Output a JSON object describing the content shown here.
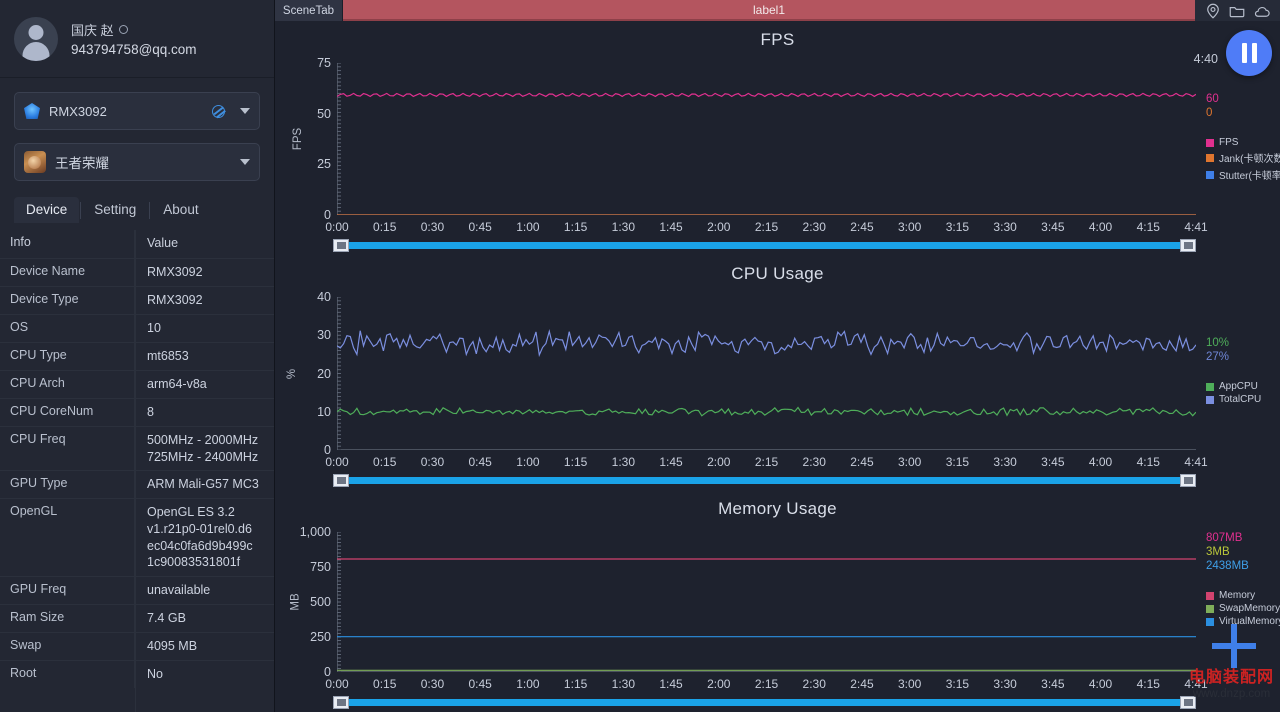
{
  "sidebar": {
    "profile": {
      "name": "国庆 赵",
      "email": "943794758@qq.com",
      "status_icon": "circle-icon",
      "avatar_icon": "avatar-icon"
    },
    "device_select": {
      "value": "RMX3092",
      "edit_icon": "pencil-icon",
      "caret_icon": "chevron-down-icon"
    },
    "game_select": {
      "value": "王者荣耀",
      "caret_icon": "chevron-down-icon"
    },
    "tabs": [
      {
        "label": "Device",
        "active": true
      },
      {
        "label": "Setting",
        "active": false
      },
      {
        "label": "About",
        "active": false
      }
    ],
    "table": {
      "headers": [
        "Info",
        "Value"
      ],
      "rows": [
        {
          "key": "Device Name",
          "value": "RMX3092"
        },
        {
          "key": "Device Type",
          "value": "RMX3092"
        },
        {
          "key": "OS",
          "value": "10"
        },
        {
          "key": "CPU Type",
          "value": "mt6853"
        },
        {
          "key": "CPU Arch",
          "value": "arm64-v8a"
        },
        {
          "key": "CPU CoreNum",
          "value": "8"
        },
        {
          "key": "CPU Freq",
          "value": "500MHz - 2000MHz\n725MHz - 2400MHz"
        },
        {
          "key": "GPU Type",
          "value": "ARM Mali-G57 MC3"
        },
        {
          "key": "OpenGL",
          "value": "OpenGL ES 3.2\nv1.r21p0-01rel0.d6\nec04c0fa6d9b499c\n1c90083531801f"
        },
        {
          "key": "GPU Freq",
          "value": "unavailable"
        },
        {
          "key": "Ram Size",
          "value": "7.4 GB"
        },
        {
          "key": "Swap",
          "value": "4095 MB"
        },
        {
          "key": "Root",
          "value": "No"
        }
      ]
    }
  },
  "topbar": {
    "scene_tab": "SceneTab",
    "label": "label1",
    "icons": [
      "location-pin-icon",
      "folder-icon",
      "cloud-icon"
    ],
    "accent_red": "#b4555f"
  },
  "controls": {
    "pause_button": "pause-icon",
    "elapsed": "4:40"
  },
  "watermark": {
    "cn": "电脑装配",
    "cn_accent": "网",
    "url": "www.dnzp.com"
  },
  "chart_data": [
    {
      "type": "line",
      "title": "FPS",
      "ylabel": "FPS",
      "xlabel": "",
      "ylim": [
        0,
        75
      ],
      "yticks": [
        0,
        25,
        50,
        75
      ],
      "ytick_labels": [
        "0",
        "25",
        "50",
        "75"
      ],
      "xticks": [
        "0:00",
        "0:15",
        "0:30",
        "0:45",
        "1:00",
        "1:15",
        "1:30",
        "1:45",
        "2:00",
        "2:15",
        "2:30",
        "2:45",
        "3:00",
        "3:15",
        "3:30",
        "3:45",
        "4:00",
        "4:15",
        "4:41"
      ],
      "grid": false,
      "legend_position": "right",
      "current_values": [
        {
          "label": "60",
          "color": "#e0308f"
        },
        {
          "label": "0",
          "color": "#e0762f"
        }
      ],
      "series": [
        {
          "name": "FPS",
          "color": "#e0308f",
          "mean": 60,
          "amplitude": 1.5,
          "note": "oscillating near 60"
        },
        {
          "name": "Jank(卡顿次数)",
          "color": "#e0762f",
          "mean": 0,
          "amplitude": 0
        },
        {
          "name": "Stutter(卡顿率)",
          "color": "#3f7fe8",
          "mean": 0,
          "amplitude": 0
        }
      ]
    },
    {
      "type": "line",
      "title": "CPU Usage",
      "ylabel": "%",
      "xlabel": "",
      "ylim": [
        0,
        40
      ],
      "yticks": [
        0,
        10,
        20,
        30,
        40
      ],
      "ytick_labels": [
        "0",
        "10",
        "20",
        "30",
        "40"
      ],
      "xticks": [
        "0:00",
        "0:15",
        "0:30",
        "0:45",
        "1:00",
        "1:15",
        "1:30",
        "1:45",
        "2:00",
        "2:15",
        "2:30",
        "2:45",
        "3:00",
        "3:15",
        "3:30",
        "3:45",
        "4:00",
        "4:15",
        "4:41"
      ],
      "grid": false,
      "legend_position": "right",
      "current_values": [
        {
          "label": "10%",
          "color": "#4fae5a"
        },
        {
          "label": "27%",
          "color": "#6f86d6"
        }
      ],
      "series": [
        {
          "name": "AppCPU",
          "color": "#4fae5a",
          "mean": 10,
          "amplitude": 1.1
        },
        {
          "name": "TotalCPU",
          "color": "#7b8fe0",
          "mean": 28,
          "amplitude": 3.2
        }
      ]
    },
    {
      "type": "line",
      "title": "Memory Usage",
      "ylabel": "MB",
      "xlabel": "",
      "ylim": [
        0,
        1000
      ],
      "yticks": [
        0,
        250,
        500,
        750,
        1000
      ],
      "ytick_labels": [
        "0",
        "250",
        "500",
        "750",
        "1,000"
      ],
      "xticks": [
        "0:00",
        "0:15",
        "0:30",
        "0:45",
        "1:00",
        "1:15",
        "1:30",
        "1:45",
        "2:00",
        "2:15",
        "2:30",
        "2:45",
        "3:00",
        "3:15",
        "3:30",
        "3:45",
        "4:00",
        "4:15",
        "4:41"
      ],
      "grid": false,
      "legend_position": "right",
      "current_values": [
        {
          "label": "807MB",
          "color": "#e0308f"
        },
        {
          "label": "3MB",
          "color": "#b9c63a"
        },
        {
          "label": "2438MB",
          "color": "#3f9fe8"
        }
      ],
      "series": [
        {
          "name": "Memory",
          "color": "#d2436f",
          "mean": 807,
          "amplitude": 0
        },
        {
          "name": "SwapMemory",
          "color": "#7fae5a",
          "mean": 12,
          "amplitude": 0
        },
        {
          "name": "VirtualMemory",
          "color": "#2b8fe0",
          "mean": 252,
          "amplitude": 0
        }
      ]
    }
  ]
}
